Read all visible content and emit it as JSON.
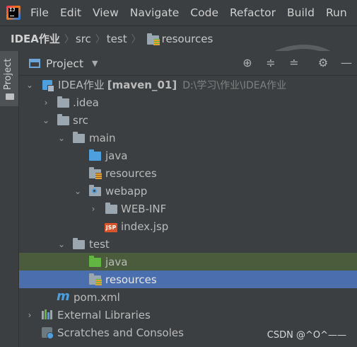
{
  "menu": [
    "File",
    "Edit",
    "View",
    "Navigate",
    "Code",
    "Refactor",
    "Build",
    "Run",
    "To"
  ],
  "breadcrumbs": [
    "IDEA作业",
    "src",
    "test",
    "resources"
  ],
  "side_tab": "Project",
  "panel": {
    "title": "Project"
  },
  "tree": [
    {
      "label": "IDEA作业",
      "suffix": "[maven_01]",
      "path": "D:\\学习\\作业\\IDEA作业",
      "icon": "module-icon",
      "arrow": "expanded"
    },
    {
      "label": ".idea",
      "icon": "folder-icon",
      "arrow": "collapsed"
    },
    {
      "label": "src",
      "icon": "folder-icon",
      "arrow": "expanded"
    },
    {
      "label": "main",
      "icon": "folder-icon",
      "arrow": "expanded"
    },
    {
      "label": "java",
      "icon": "source-folder-icon"
    },
    {
      "label": "resources",
      "icon": "resources-folder-icon"
    },
    {
      "label": "webapp",
      "icon": "web-folder-icon",
      "arrow": "expanded"
    },
    {
      "label": "WEB-INF",
      "icon": "folder-icon",
      "arrow": "collapsed"
    },
    {
      "label": "index.jsp",
      "icon": "jsp-file-icon"
    },
    {
      "label": "test",
      "icon": "folder-icon",
      "arrow": "expanded"
    },
    {
      "label": "java",
      "icon": "test-source-folder-icon"
    },
    {
      "label": "resources",
      "icon": "test-resources-folder-icon"
    },
    {
      "label": "pom.xml",
      "icon": "maven-icon"
    },
    {
      "label": "External Libraries",
      "icon": "libraries-icon",
      "arrow": "collapsed"
    },
    {
      "label": "Scratches and Consoles",
      "icon": "scratches-icon"
    }
  ],
  "watermark": "CSDN @^O^——",
  "colors": {
    "background": "#3c3f41",
    "selected_row": "#4b6eaf",
    "test_source_row": "#4a5c3c",
    "folder": "#9aa7b0",
    "source_folder": "#4e9fde",
    "test_folder": "#62b543"
  }
}
